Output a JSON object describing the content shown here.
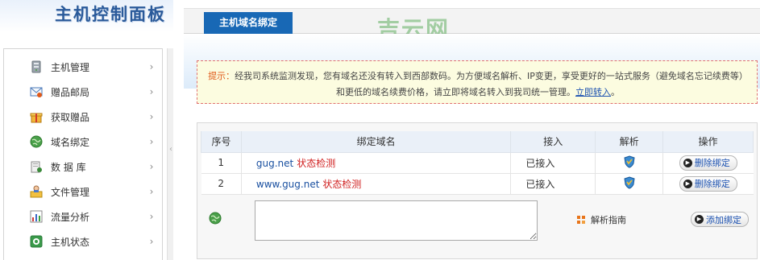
{
  "panel_title": "主机控制面板",
  "sidebar": {
    "items": [
      {
        "label": "主机管理",
        "icon": "server-icon"
      },
      {
        "label": "赠品邮局",
        "icon": "mail-icon"
      },
      {
        "label": "获取赠品",
        "icon": "gift-icon"
      },
      {
        "label": "域名绑定",
        "icon": "globe-icon"
      },
      {
        "label": "数 据 库",
        "icon": "database-icon"
      },
      {
        "label": "文件管理",
        "icon": "folder-user-icon"
      },
      {
        "label": "流量分析",
        "icon": "chart-icon"
      },
      {
        "label": "主机状态",
        "icon": "status-icon"
      }
    ],
    "arrow": "›",
    "collapse_arrow": "‹"
  },
  "main": {
    "tab_label": "主机域名绑定",
    "watermark": "吉云网",
    "notice": {
      "prefix": "提示：",
      "text": "经我司系统监测发现，您有域名还没有转入到西部数码。为方便域名解析、IP变更，享受更好的一站式服务（避免域名忘记续费等）和更低的域名续费价格，请立即将域名转入到我司统一管理。",
      "link": "立即转入",
      "suffix": "。"
    },
    "table": {
      "headers": [
        "序号",
        "绑定域名",
        "接入",
        "解析",
        "操作"
      ],
      "rows": [
        {
          "no": "1",
          "domain": "gug.net",
          "check": "状态检测",
          "access": "已接入",
          "action": "删除绑定"
        },
        {
          "no": "2",
          "domain": "www.gug.net",
          "check": "状态检测",
          "access": "已接入",
          "action": "删除绑定"
        }
      ]
    },
    "add": {
      "input_value": "",
      "guide_label": "解析指南",
      "add_button": "添加绑定"
    }
  },
  "colors": {
    "tab_bg": "#1868b5",
    "notice_hint": "#e05a1a",
    "check_link": "#d02020",
    "link": "#1a50b0"
  }
}
